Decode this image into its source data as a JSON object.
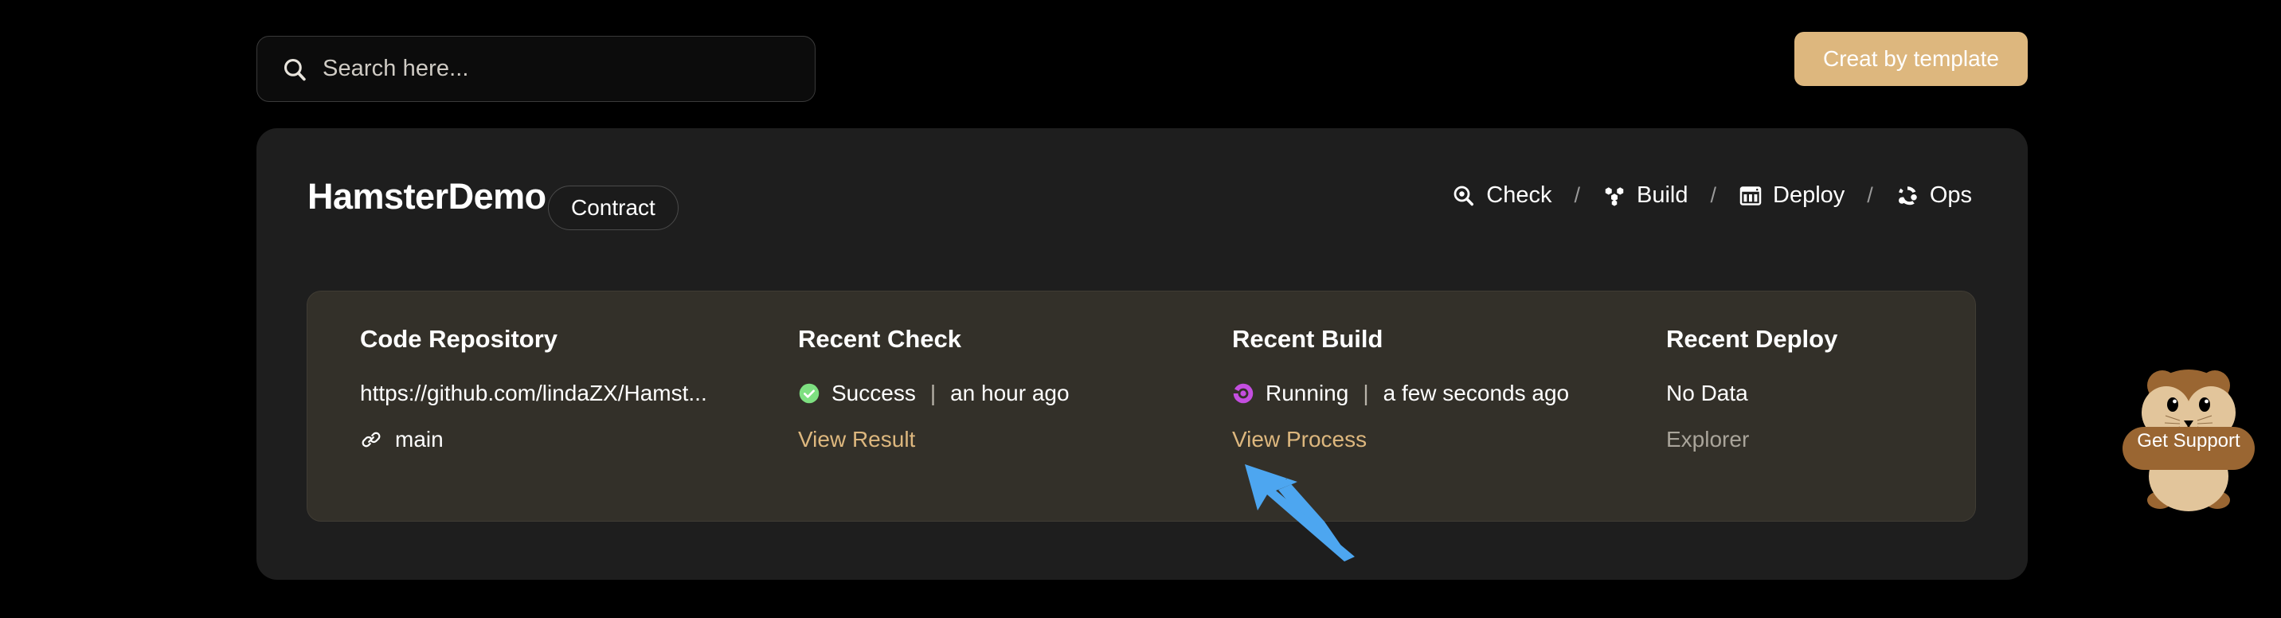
{
  "topbar": {
    "search": {
      "icon": "search-icon",
      "placeholder": "Search here...",
      "value": ""
    },
    "create_button": {
      "label": "Creat by template",
      "color": "#ddb77e"
    }
  },
  "project": {
    "name": "HamsterDemo",
    "badge": "Contract",
    "nav": [
      {
        "label": "Check",
        "icon": "magnifier-icon"
      },
      {
        "separator": "/"
      },
      {
        "label": "Build",
        "icon": "cubes-icon"
      },
      {
        "separator": "/"
      },
      {
        "label": "Deploy",
        "icon": "server-grid-icon"
      },
      {
        "separator": "/"
      },
      {
        "label": "Ops",
        "icon": "nodes-icon"
      }
    ]
  },
  "info": {
    "repository": {
      "title": "Code Repository",
      "url": "https://github.com/lindaZX/Hamst...",
      "branch_icon": "link-icon",
      "branch": "main"
    },
    "check": {
      "title": "Recent Check",
      "status_icon": "check-circle-icon",
      "status_color": "#7ee081",
      "status": "Success",
      "separator": "|",
      "time": "an hour ago",
      "action": "View Result"
    },
    "build": {
      "title": "Recent Build",
      "status_icon": "spinner-icon",
      "status_color": "#c44ee0",
      "status": "Running",
      "separator": "|",
      "time": "a few seconds ago",
      "action": "View Process"
    },
    "deploy": {
      "title": "Recent Deploy",
      "status": "No Data",
      "action": "Explorer"
    }
  },
  "annotation": {
    "arrow_icon": "pointer-arrow-icon",
    "arrow_color": "#4da6f0",
    "points_at": "View Process"
  },
  "support": {
    "label": "Get Support",
    "icon": "hamster-mascot-icon"
  }
}
